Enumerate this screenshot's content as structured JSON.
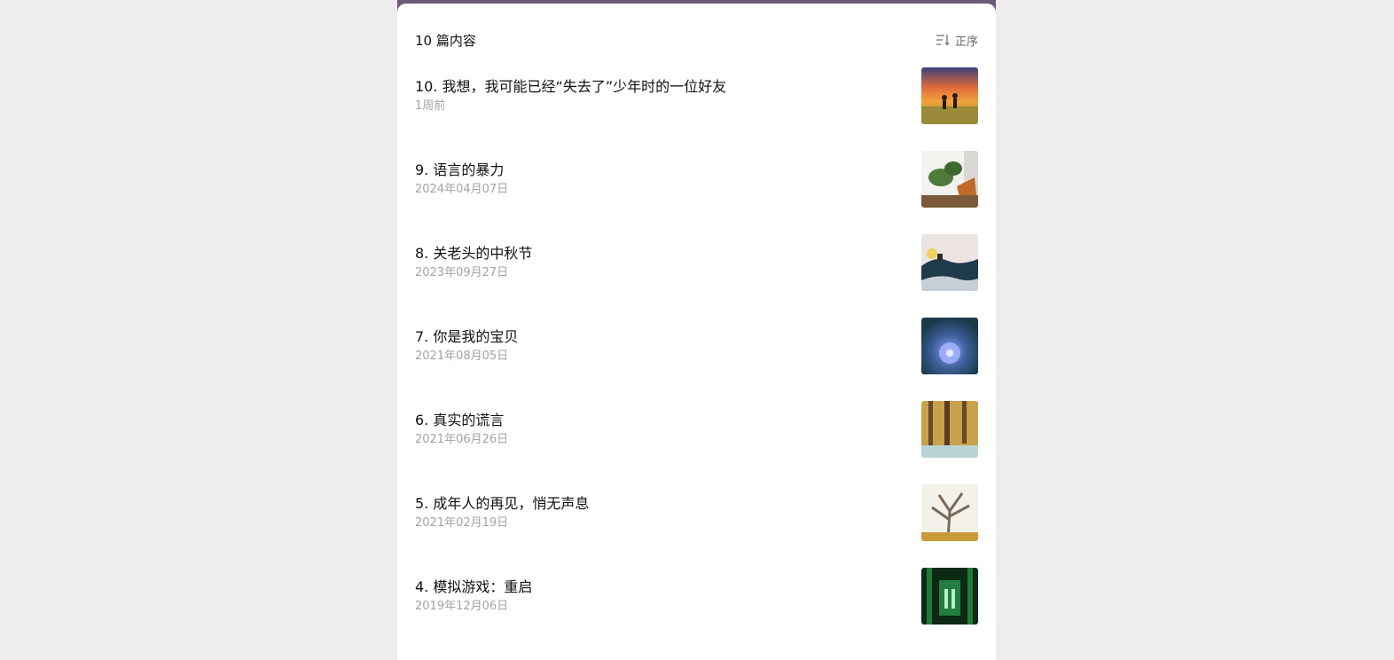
{
  "header": {
    "count_label": "10 篇内容",
    "sort_label": "正序",
    "sort_icon": "sort-icon"
  },
  "articles": [
    {
      "title": "10. 我想，我可能已经“失去了”少年时的一位好友",
      "date": "1周前",
      "thumb": "sunset-kids-running"
    },
    {
      "title": "9. 语言的暴力",
      "date": "2024年04月07日",
      "thumb": "plant-by-window"
    },
    {
      "title": "8. 关老头的中秋节",
      "date": "2023年09月27日",
      "thumb": "moon-over-mountain"
    },
    {
      "title": "7. 你是我的宝贝",
      "date": "2021年08月05日",
      "thumb": "blue-flower"
    },
    {
      "title": "6. 真实的谎言",
      "date": "2021年06月26日",
      "thumb": "autumn-forest"
    },
    {
      "title": "5. 成年人的再见，悄无声息",
      "date": "2021年02月19日",
      "thumb": "bare-tree"
    },
    {
      "title": "4. 模拟游戏：重启",
      "date": "2019年12月06日",
      "thumb": "green-matrix-corridor"
    }
  ],
  "colors": {
    "topbar": "#6f5a74",
    "background": "#ededed",
    "title": "#111111",
    "date": "#a3a3a3"
  }
}
